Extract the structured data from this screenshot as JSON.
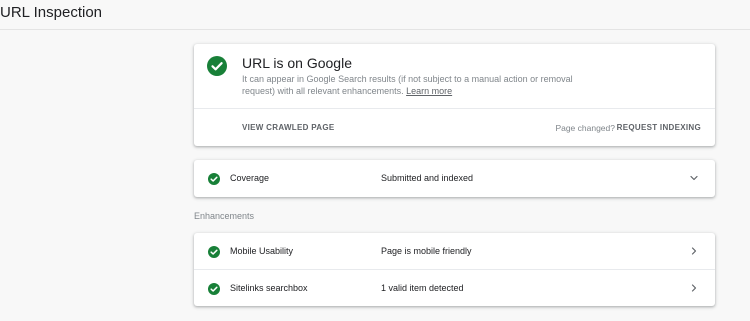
{
  "header": {
    "title": "URL Inspection"
  },
  "status": {
    "title": "URL is on Google",
    "description": "It can appear in Google Search results (if not subject to a manual action or removal request) with all relevant enhancements.",
    "learn_more": "Learn more",
    "view_crawled_label": "VIEW CRAWLED PAGE",
    "page_changed_label": "Page changed?",
    "request_indexing_label": "REQUEST INDEXING"
  },
  "coverage": {
    "label": "Coverage",
    "value": "Submitted and indexed"
  },
  "enhancements": {
    "section_label": "Enhancements",
    "items": [
      {
        "label": "Mobile Usability",
        "value": "Page is mobile friendly"
      },
      {
        "label": "Sitelinks searchbox",
        "value": "1 valid item detected"
      }
    ]
  },
  "colors": {
    "success_green": "#188038",
    "muted_text": "#80868b",
    "link_gray": "#5f6368"
  },
  "icons": {
    "status": "check-circle-icon",
    "expand": "chevron-down-icon",
    "navigate": "chevron-right-icon"
  }
}
